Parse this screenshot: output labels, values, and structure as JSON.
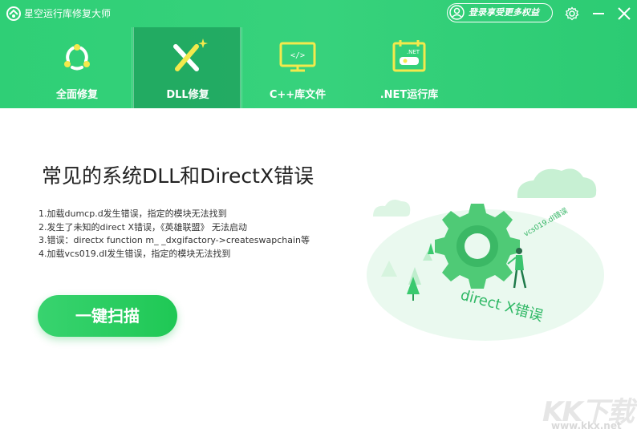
{
  "app": {
    "title": "星空运行库修复大师"
  },
  "header": {
    "login_label": "登录享受更多权益"
  },
  "tabs": [
    {
      "label": "全面修复",
      "icon": "repair-cycle-icon",
      "active": false
    },
    {
      "label": "DLL修复",
      "icon": "dll-tools-icon",
      "active": true
    },
    {
      "label": "C++库文件",
      "icon": "code-monitor-icon",
      "active": false
    },
    {
      "label": ".NET运行库",
      "icon": "dotnet-calendar-icon",
      "active": false
    }
  ],
  "main": {
    "title": "常见的系统DLL和DirectX错误",
    "errors": [
      "1.加载dumcp.d发生错误，指定的模块无法找到",
      "2.发生了未知的direct X错误，《英雄联盟》 无法启动",
      "3.错误：directx  function  m_  _dxgifactory->createswapchain等",
      "4.加载vcs019.dl发生错误，指定的模块无法找到"
    ],
    "scan_button": "一键扫描"
  },
  "illustration": {
    "caption_main": "direct X错误",
    "caption_small": "vcs019.dl错误"
  },
  "watermark": {
    "brand": "KK下载",
    "url": "www.kkx.net"
  },
  "colors": {
    "accent": "#2fcf76",
    "button": "#1fc855"
  }
}
